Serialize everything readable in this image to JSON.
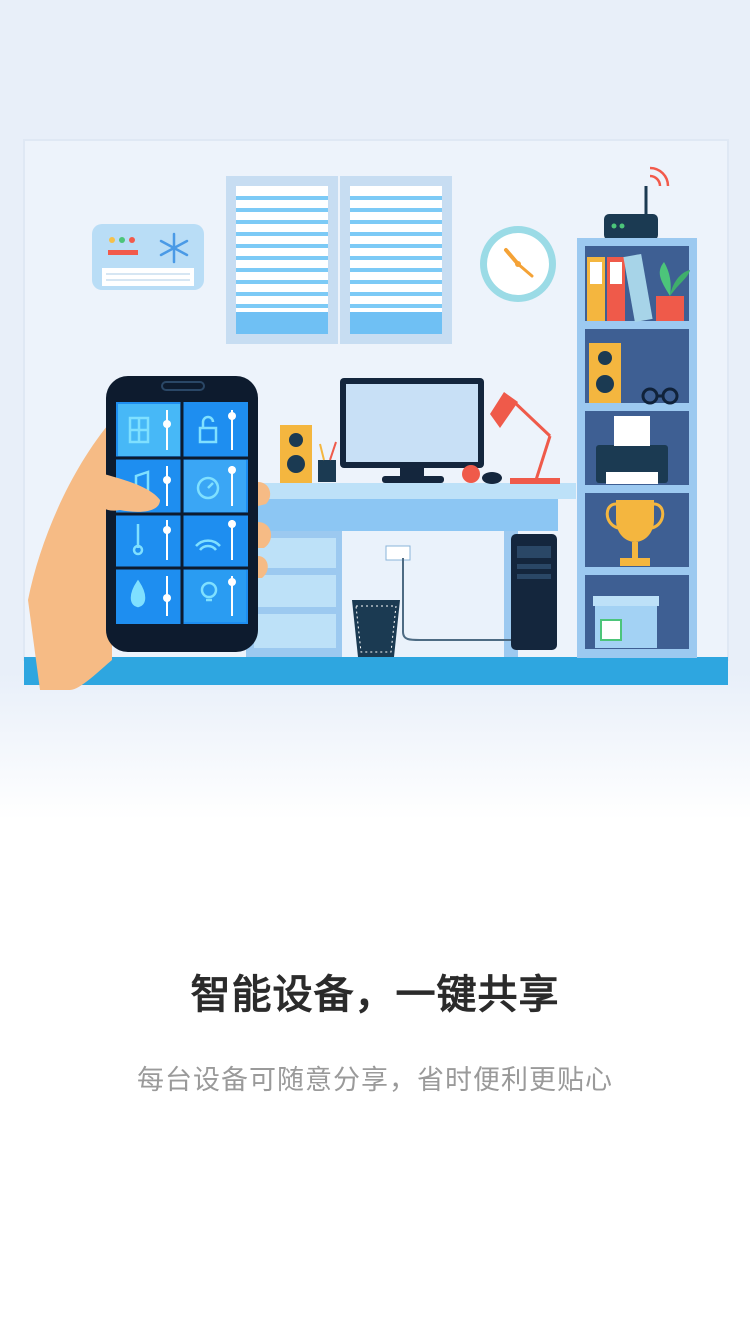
{
  "onboarding": {
    "title": "智能设备，一键共享",
    "subtitle": "每台设备可随意分享，省时便利更贴心"
  },
  "illustration": {
    "objects": [
      "air-conditioner",
      "window-blinds",
      "wall-clock",
      "wifi-router",
      "bookshelf",
      "desk",
      "monitor",
      "desk-lamp",
      "speaker",
      "printer",
      "trophy",
      "trash-bin",
      "pc-tower",
      "smartphone-in-hand"
    ],
    "phone_controls": [
      "window-icon",
      "lock-icon",
      "music-icon",
      "timer-icon",
      "thermometer-icon",
      "wifi-icon",
      "water-drop-icon",
      "light-bulb-icon"
    ]
  },
  "colors": {
    "background": "#e8eff9",
    "title": "#2b2b2b",
    "subtitle": "#9a9a9a",
    "accent_blue": "#2ea6e0",
    "phone_tile": "#1e8ef0"
  }
}
